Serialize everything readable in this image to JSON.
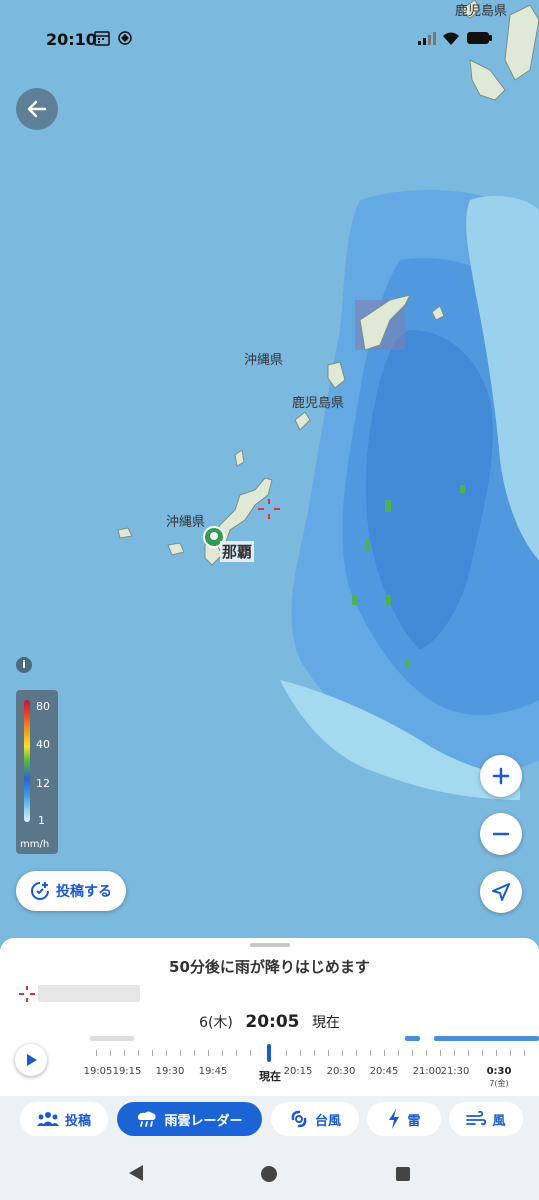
{
  "status_bar": {
    "time": "20:10"
  },
  "map": {
    "labels": {
      "kagoshima_top": "鹿児島県",
      "okinawa_north": "沖縄県",
      "kagoshima_mid": "鹿児島県",
      "okinawa_main": "沖縄県",
      "naha": "那覇"
    }
  },
  "legend": {
    "levels": [
      "80",
      "40",
      "12",
      "1"
    ],
    "unit": "mm/h"
  },
  "post_button": {
    "label": "投稿する"
  },
  "sheet": {
    "forecast_message": "50分後に雨が降りはじめます",
    "date": "6(木)",
    "time": "20:05",
    "now_label": "現在"
  },
  "timeline": {
    "labels": [
      "19:05",
      "19:15",
      "19:30",
      "19:45",
      "現在",
      "20:15",
      "20:30",
      "20:45",
      "21:00",
      "21:30",
      "0:30"
    ],
    "next_day": "7(金)"
  },
  "tabs": [
    {
      "label": "投稿",
      "icon": "people-icon",
      "active": false
    },
    {
      "label": "雨雲レーダー",
      "icon": "rain-cloud-icon",
      "active": true
    },
    {
      "label": "台風",
      "icon": "typhoon-icon",
      "active": false
    },
    {
      "label": "雷",
      "icon": "lightning-icon",
      "active": false
    },
    {
      "label": "風",
      "icon": "wind-icon",
      "active": false
    }
  ]
}
